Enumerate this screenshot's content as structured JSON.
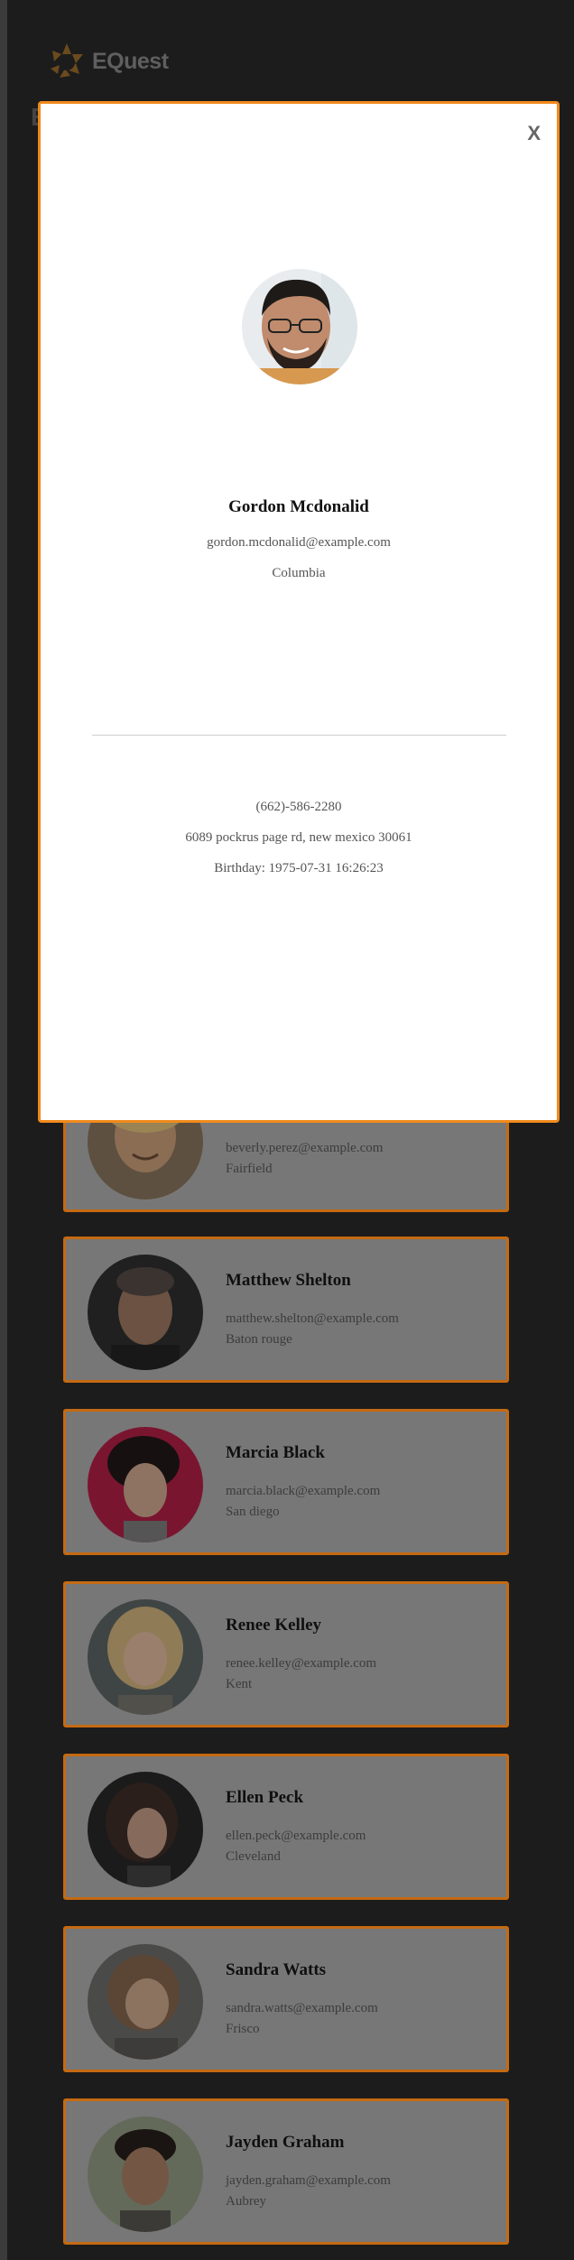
{
  "brand": {
    "name": "EQuest"
  },
  "modal": {
    "close_label": "X",
    "name": "Gordon Mcdonalid",
    "email": "gordon.mcdonalid@example.com",
    "city": "Columbia",
    "phone": "(662)-586-2280",
    "address": "6089 pockrus page rd, new mexico 30061",
    "birthday": "Birthday: 1975-07-31 16:26:23"
  },
  "users": [
    {
      "name": "",
      "email": "beverly.perez@example.com",
      "city": "Fairfield"
    },
    {
      "name": "Matthew Shelton",
      "email": "matthew.shelton@example.com",
      "city": "Baton rouge"
    },
    {
      "name": "Marcia Black",
      "email": "marcia.black@example.com",
      "city": "San diego"
    },
    {
      "name": "Renee Kelley",
      "email": "renee.kelley@example.com",
      "city": "Kent"
    },
    {
      "name": "Ellen Peck",
      "email": "ellen.peck@example.com",
      "city": "Cleveland"
    },
    {
      "name": "Sandra Watts",
      "email": "sandra.watts@example.com",
      "city": "Frisco"
    },
    {
      "name": "Jayden Graham",
      "email": "jayden.graham@example.com",
      "city": "Aubrey"
    }
  ],
  "colors": {
    "accent": "#f08a1c",
    "card_border": "#c56a12",
    "overlay": "#1c1c1c",
    "card_bg": "#777777"
  }
}
